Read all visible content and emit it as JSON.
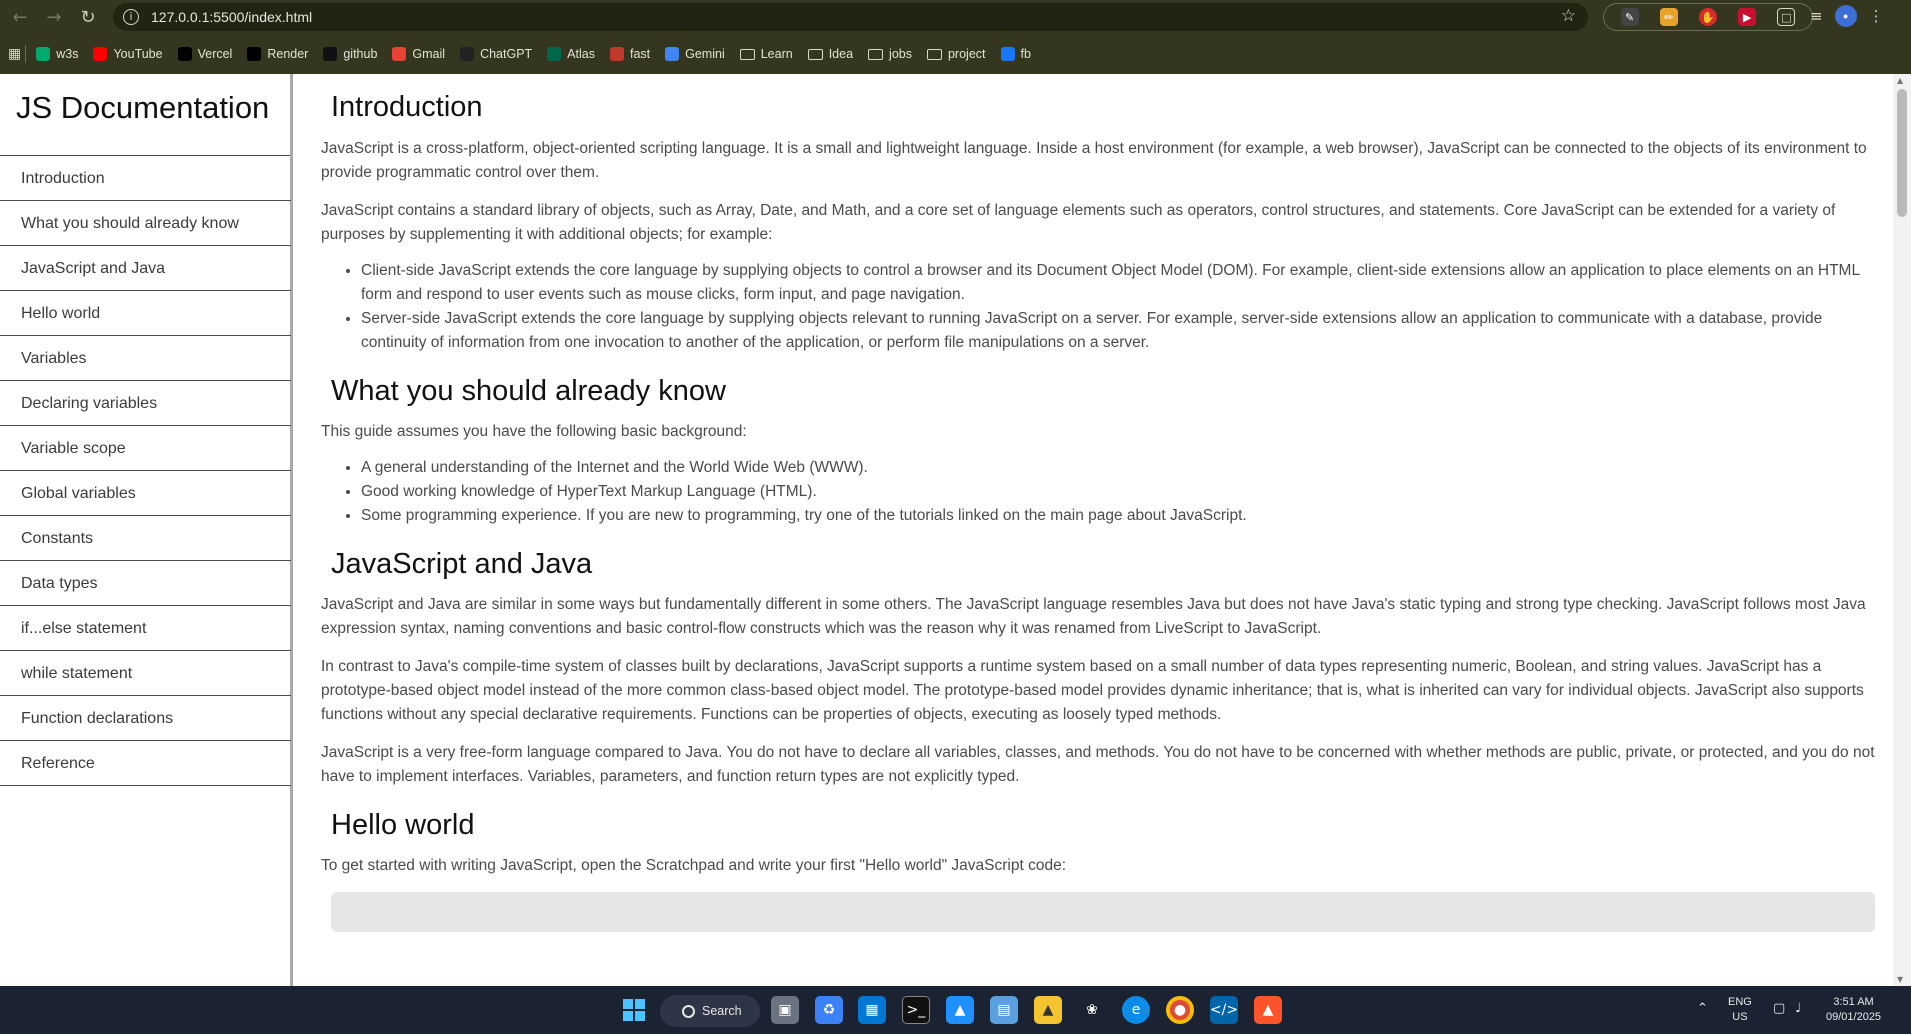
{
  "browser": {
    "url": "127.0.0.1:5500/index.html",
    "bookmarks": [
      {
        "label": "w3s",
        "icon": "w3schools-icon",
        "color": "#04aa6d"
      },
      {
        "label": "YouTube",
        "icon": "youtube-icon",
        "color": "#ff0000"
      },
      {
        "label": "Vercel",
        "icon": "vercel-icon",
        "color": "#000000"
      },
      {
        "label": "Render",
        "icon": "render-icon",
        "color": "#000000"
      },
      {
        "label": "github",
        "icon": "github-icon",
        "color": "#111111"
      },
      {
        "label": "Gmail",
        "icon": "gmail-icon",
        "color": "#ea4335"
      },
      {
        "label": "ChatGPT",
        "icon": "chatgpt-icon",
        "color": "#222222"
      },
      {
        "label": "Atlas",
        "icon": "mongodb-atlas-icon",
        "color": "#00684a"
      },
      {
        "label": "fast",
        "icon": "fast-icon",
        "color": "#c0392b"
      },
      {
        "label": "Gemini",
        "icon": "gemini-icon",
        "color": "#4285f4"
      },
      {
        "label": "Learn",
        "icon": "folder-icon"
      },
      {
        "label": "Idea",
        "icon": "folder-icon"
      },
      {
        "label": "jobs",
        "icon": "folder-icon"
      },
      {
        "label": "project",
        "icon": "folder-icon"
      },
      {
        "label": "fb",
        "icon": "facebook-icon",
        "color": "#1877f2"
      }
    ]
  },
  "navbar": {
    "title": "JS Documentation",
    "links": [
      "Introduction",
      "What you should already know",
      "JavaScript and Java",
      "Hello world",
      "Variables",
      "Declaring variables",
      "Variable scope",
      "Global variables",
      "Constants",
      "Data types",
      "if...else statement",
      "while statement",
      "Function declarations",
      "Reference"
    ]
  },
  "sections": {
    "introduction": {
      "title": "Introduction",
      "p1": "JavaScript is a cross-platform, object-oriented scripting language. It is a small and lightweight language. Inside a host environment (for example, a web browser), JavaScript can be connected to the objects of its environment to provide programmatic control over them.",
      "p2": "JavaScript contains a standard library of objects, such as Array, Date, and Math, and a core set of language elements such as operators, control structures, and statements. Core JavaScript can be extended for a variety of purposes by supplementing it with additional objects; for example:",
      "li1": "Client-side JavaScript extends the core language by supplying objects to control a browser and its Document Object Model (DOM). For example, client-side extensions allow an application to place elements on an HTML form and respond to user events such as mouse clicks, form input, and page navigation.",
      "li2": "Server-side JavaScript extends the core language by supplying objects relevant to running JavaScript on a server. For example, server-side extensions allow an application to communicate with a database, provide continuity of information from one invocation to another of the application, or perform file manipulations on a server."
    },
    "know": {
      "title": "What you should already know",
      "p1": "This guide assumes you have the following basic background:",
      "li1": "A general understanding of the Internet and the World Wide Web (WWW).",
      "li2": "Good working knowledge of HyperText Markup Language (HTML).",
      "li3": "Some programming experience. If you are new to programming, try one of the tutorials linked on the main page about JavaScript."
    },
    "java": {
      "title": "JavaScript and Java",
      "p1": "JavaScript and Java are similar in some ways but fundamentally different in some others. The JavaScript language resembles Java but does not have Java's static typing and strong type checking. JavaScript follows most Java expression syntax, naming conventions and basic control-flow constructs which was the reason why it was renamed from LiveScript to JavaScript.",
      "p2": "In contrast to Java's compile-time system of classes built by declarations, JavaScript supports a runtime system based on a small number of data types representing numeric, Boolean, and string values. JavaScript has a prototype-based object model instead of the more common class-based object model. The prototype-based model provides dynamic inheritance; that is, what is inherited can vary for individual objects. JavaScript also supports functions without any special declarative requirements. Functions can be properties of objects, executing as loosely typed methods.",
      "p3": "JavaScript is a very free-form language compared to Java. You do not have to declare all variables, classes, and methods. You do not have to be concerned with whether methods are public, private, or protected, and you do not have to implement interfaces. Variables, parameters, and function return types are not explicitly typed."
    },
    "hello": {
      "title": "Hello world",
      "p1": "To get started with writing JavaScript, open the Scratchpad and write your first \"Hello world\" JavaScript code:"
    }
  },
  "taskbar": {
    "search_label": "Search",
    "lang_top": "ENG",
    "lang_bottom": "US",
    "time": "3:51 AM",
    "date": "09/01/2025"
  }
}
